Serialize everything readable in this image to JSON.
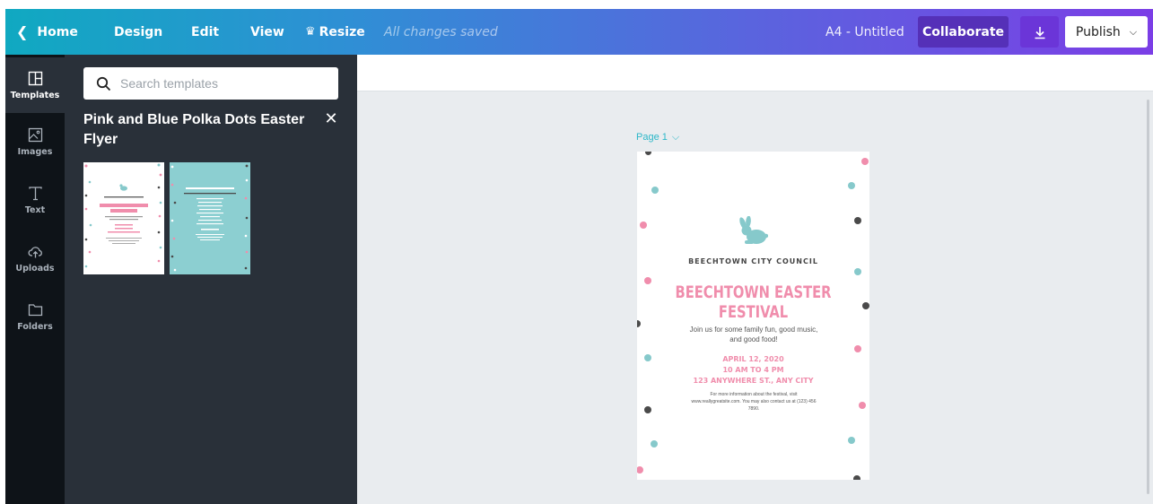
{
  "topbar": {
    "home_label": "Home",
    "design_label": "Design",
    "edit_label": "Edit",
    "view_label": "View",
    "resize_label": "Resize",
    "saved_status": "All changes saved",
    "document_name": "A4 - Untitled",
    "collaborate_label": "Collaborate",
    "publish_label": "Publish"
  },
  "sidebar": {
    "items": [
      {
        "label": "Templates",
        "icon": "templates-icon"
      },
      {
        "label": "Images",
        "icon": "image-icon"
      },
      {
        "label": "Text",
        "icon": "text-icon"
      },
      {
        "label": "Uploads",
        "icon": "upload-cloud-icon"
      },
      {
        "label": "Folders",
        "icon": "folder-icon"
      }
    ]
  },
  "panel": {
    "search_placeholder": "Search templates",
    "template_title": "Pink and Blue Polka Dots Easter Flyer"
  },
  "canvas": {
    "page_label": "Page 1"
  },
  "flyer": {
    "council": "BEECHTOWN CITY COUNCIL",
    "title_line1": "BEECHTOWN EASTER",
    "title_line2": "FESTIVAL",
    "intro": "Join us for some family fun, good music, and good food!",
    "date": "APRIL 12, 2020",
    "time": "10 AM TO 4 PM",
    "address": "123 ANYWHERE ST., ANY CITY",
    "more_info": "For more information about the festival, visit www.reallygreatsite.com. You may also contact us at (123) 456 7890."
  },
  "colors": {
    "pink": "#f08dac",
    "teal": "#86c9cb",
    "charcoal": "#4a4a4a"
  }
}
